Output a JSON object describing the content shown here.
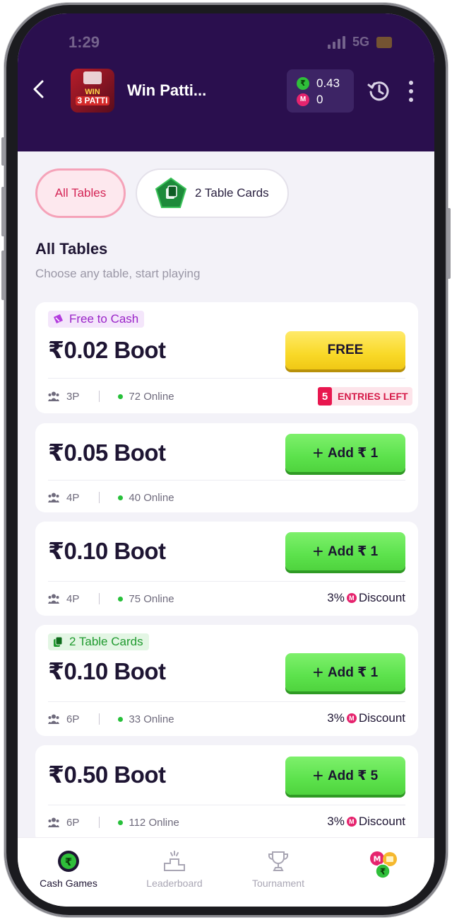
{
  "status_bar": {
    "time": "1:29",
    "network": "5G"
  },
  "header": {
    "game_title": "Win Patti...",
    "logo_text_top": "WIN",
    "logo_text_bottom": "3 PATTI",
    "wallet": {
      "cash_balance": "0.43",
      "coin_balance": "0"
    }
  },
  "filters": {
    "all_tables_label": "All Tables",
    "table_cards_label": "2 Table Cards"
  },
  "section": {
    "title": "All Tables",
    "subtitle": "Choose any table, start playing"
  },
  "tables": [
    {
      "tag": "Free to Cash",
      "boot": "₹0.02 Boot",
      "button_label": "FREE",
      "players": "3P",
      "online": "72 Online",
      "entries_count": "5",
      "entries_label": "ENTRIES LEFT"
    },
    {
      "boot": "₹0.05 Boot",
      "button_label": "Add ₹ 1",
      "players": "4P",
      "online": "40 Online"
    },
    {
      "boot": "₹0.10 Boot",
      "button_label": "Add ₹ 1",
      "players": "4P",
      "online": "75 Online",
      "discount_pct": "3%",
      "discount_label": "Discount"
    },
    {
      "tag": "2 Table Cards",
      "boot": "₹0.10 Boot",
      "button_label": "Add ₹ 1",
      "players": "6P",
      "online": "33 Online",
      "discount_pct": "3%",
      "discount_label": "Discount"
    },
    {
      "boot": "₹0.50 Boot",
      "button_label": "Add ₹ 5",
      "players": "6P",
      "online": "112 Online",
      "discount_pct": "3%",
      "discount_label": "Discount"
    }
  ],
  "bottom_nav": [
    {
      "label": "Cash Games",
      "icon": "rupee-icon",
      "active": true
    },
    {
      "label": "Leaderboard",
      "icon": "podium-icon"
    },
    {
      "label": "Tournament",
      "icon": "trophy-icon"
    },
    {
      "label": "",
      "icon": "coins-icon"
    }
  ],
  "colors": {
    "header_bg": "#2a0f4e",
    "accent_pink": "#e8174f",
    "button_green": "#5ce24c",
    "button_yellow": "#f9d928"
  }
}
